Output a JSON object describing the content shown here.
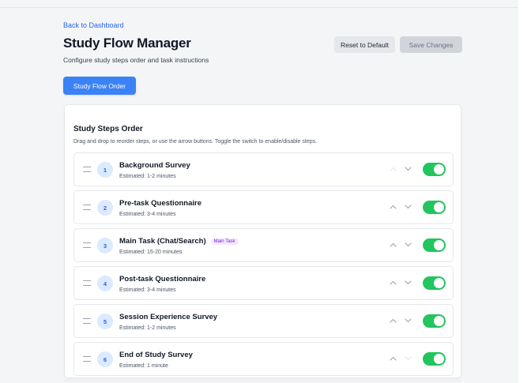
{
  "header": {
    "back_link": "Back to Dashboard",
    "title": "Study Flow Manager",
    "subtitle": "Configure study steps order and task instructions",
    "reset_label": "Reset to Default",
    "save_label": "Save Changes"
  },
  "tabs": {
    "active_label": "Study Flow Order"
  },
  "steps_card": {
    "title": "Study Steps Order",
    "description": "Drag and drop to reorder steps, or use the arrow buttons. Toggle the switch to enable/disable steps."
  },
  "colors": {
    "accent": "#3b82f6",
    "toggle_on": "#22c55e",
    "badge_bg": "#dbeafe",
    "main_task_badge": "#7e22ce"
  },
  "steps": [
    {
      "number": "1",
      "title": "Background Survey",
      "estimate": "Estimated: 1-2 minutes",
      "badge": "",
      "enabled": true,
      "can_move_up": false,
      "can_move_down": true
    },
    {
      "number": "2",
      "title": "Pre-task Questionnaire",
      "estimate": "Estimated: 3-4 minutes",
      "badge": "",
      "enabled": true,
      "can_move_up": true,
      "can_move_down": true
    },
    {
      "number": "3",
      "title": "Main Task (Chat/Search)",
      "estimate": "Estimated: 15-20 minutes",
      "badge": "Main Task",
      "enabled": true,
      "can_move_up": true,
      "can_move_down": true
    },
    {
      "number": "4",
      "title": "Post-task Questionnaire",
      "estimate": "Estimated: 3-4 minutes",
      "badge": "",
      "enabled": true,
      "can_move_up": true,
      "can_move_down": true
    },
    {
      "number": "5",
      "title": "Session Experience Survey",
      "estimate": "Estimated: 1-2 minutes",
      "badge": "",
      "enabled": true,
      "can_move_up": true,
      "can_move_down": true
    },
    {
      "number": "6",
      "title": "End of Study Survey",
      "estimate": "Estimated: 1 minute",
      "badge": "",
      "enabled": true,
      "can_move_up": true,
      "can_move_down": false
    }
  ]
}
